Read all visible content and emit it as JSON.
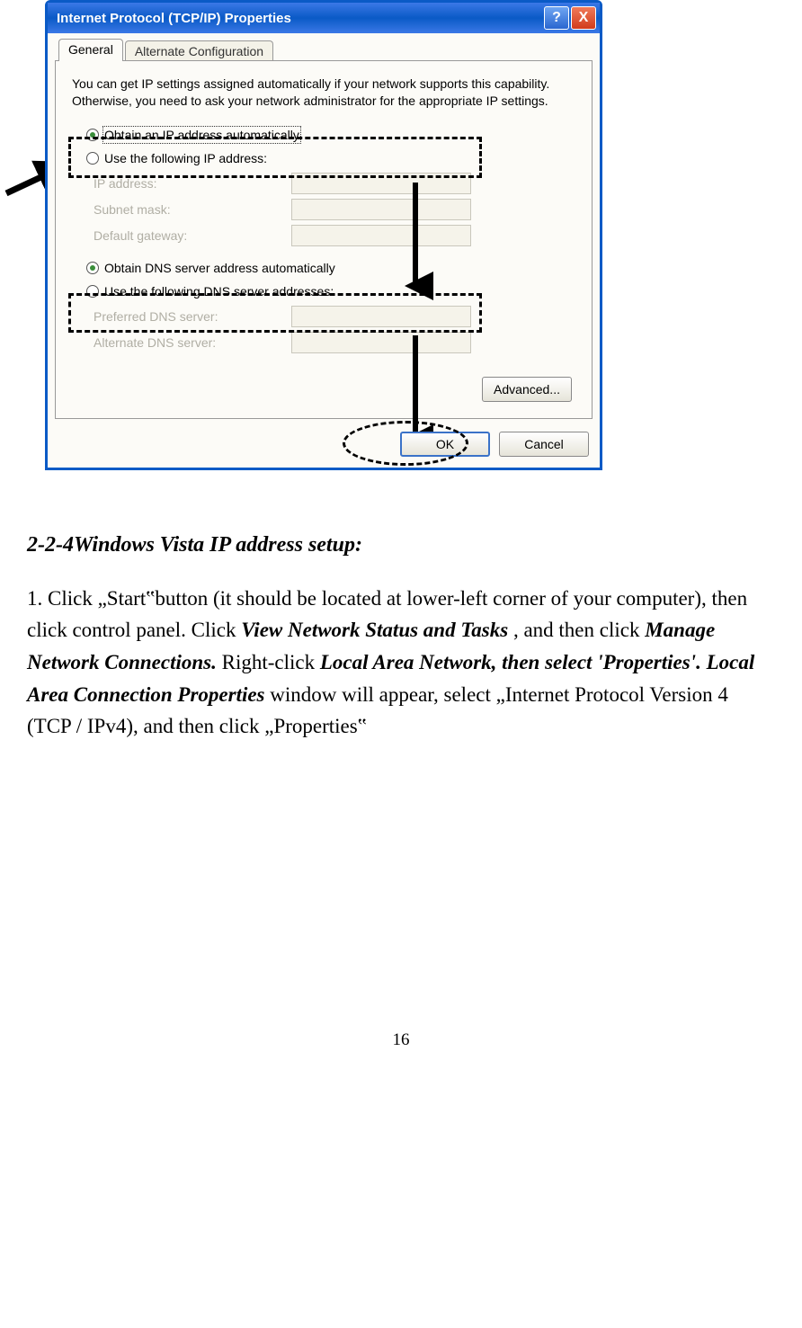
{
  "dialog": {
    "title": "Internet Protocol (TCP/IP) Properties",
    "help_label": "?",
    "close_label": "X",
    "tabs": {
      "general": "General",
      "alternate": "Alternate Configuration"
    },
    "description": "You can get IP settings assigned automatically if your network supports this capability. Otherwise, you need to ask your network administrator for the appropriate IP settings.",
    "radio_obtain_ip": "Obtain an IP address automatically",
    "radio_use_ip": "Use the following IP address:",
    "field_ip": "IP address:",
    "field_subnet": "Subnet mask:",
    "field_gateway": "Default gateway:",
    "radio_obtain_dns": "Obtain DNS server address automatically",
    "radio_use_dns": "Use the following DNS server addresses:",
    "field_pref_dns": "Preferred DNS server:",
    "field_alt_dns": "Alternate DNS server:",
    "advanced_btn": "Advanced...",
    "ok_btn": "OK",
    "cancel_btn": "Cancel"
  },
  "doc": {
    "heading": "2-2-4Windows Vista IP address setup:",
    "p1_a": "1. Click „Start‟button (it should be located at lower-left corner of your computer), then click control panel. Click ",
    "p1_b": "View Network Status and Tasks",
    "p1_c": ", and then click ",
    "p1_d": "Manage Network Connections.",
    "p1_e": " Right-click ",
    "p1_f": "Local Area Network, then select 'Properties'. Local Area Connection Properties",
    "p1_g": " window will appear, select „Internet Protocol Version 4 (TCP / IPv4), and then click „Properties‟",
    "page_number": "16"
  }
}
